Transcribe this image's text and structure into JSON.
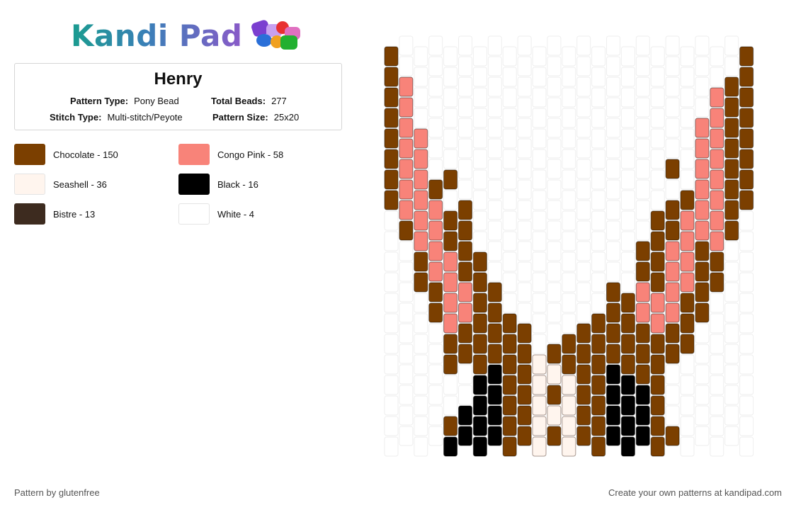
{
  "logo": {
    "text": "Kandi Pad",
    "icon": "beads-icon"
  },
  "pattern": {
    "title": "Henry",
    "type_label": "Pattern Type:",
    "type_value": "Pony Bead",
    "beads_label": "Total Beads:",
    "beads_value": "277",
    "stitch_label": "Stitch Type:",
    "stitch_value": "Multi-stitch/Peyote",
    "size_label": "Pattern Size:",
    "size_value": "25x20"
  },
  "legend": [
    {
      "label": "Chocolate - 150",
      "color": "#7b3f00"
    },
    {
      "label": "Congo Pink - 58",
      "color": "#f88379"
    },
    {
      "label": "Seashell - 36",
      "color": "#fff5ee"
    },
    {
      "label": "Black - 16",
      "color": "#000000"
    },
    {
      "label": "Bistre - 13",
      "color": "#3d2b1f"
    },
    {
      "label": "White - 4",
      "color": "#ffffff"
    }
  ],
  "footer": {
    "left": "Pattern by glutenfree",
    "right": "Create your own patterns at kandipad.com"
  },
  "bead_colors": {
    "C": "#7b3f00",
    "P": "#f88379",
    "S": "#fff5ee",
    "K": "#000000",
    "B": "#3d2b1f",
    "W": "#ffffff"
  },
  "bead_pattern": [
    "C.......................C",
    "C.......................C",
    "CP....................PCC",
    "CP....................PCC",
    "CPP..................PPCC",
    "CPP..................PPCC",
    "CPP.C..............C.PPCC",
    "CPPC................CPPCC",
    ".PPPCC............CCPPPC.",
    ".CPPCC............CCPPPC.",
    "..CPPCC..........CCPPCC..",
    "..CPPCC..........CCPPCC..",
    "...CPPCC.......CCPPPCC...",
    "...CPPCCC.....CCCPPPCC...",
    "....CCCCCC..CCCCCCCCC....",
    "....CCCCCCSCCCCCCCCC.....",
    "......KKCCSSSCCKKCC......",
    "......KKCCSCSCCKKKC......",
    "....CKKKCCSSSCCKKKC......",
    "....KKKKCCSCSCCKKKCC.....",
    "....KKKKCCSCSCCKKKSC.....",
    "....PKKCCCSSSCCKKCPC.....",
    "....PCCCBCCCCCBCCCC......",
    "....CCCCCBPCBCCCCCC......",
    "....SCCBSSPSSBCCCS.......",
    ".....SBSBPBSBSBS.........",
    ".....SSBSPSBSSS..........",
    "......SSSSSSS............"
  ]
}
